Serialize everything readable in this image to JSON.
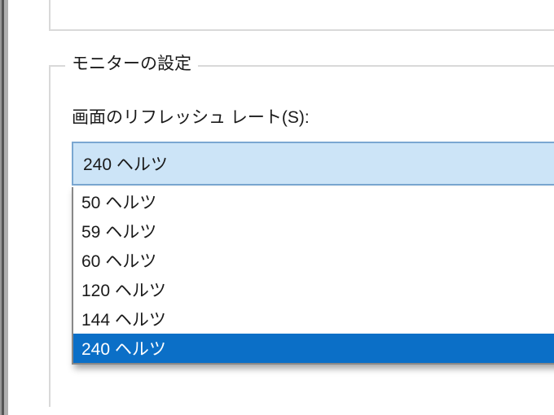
{
  "group": {
    "title": "モニターの設定"
  },
  "refresh_rate": {
    "label": "画面のリフレッシュ レート(S):",
    "selected_display": "240 ヘルツ",
    "options": [
      {
        "label": "50 ヘルツ",
        "selected": false
      },
      {
        "label": "59 ヘルツ",
        "selected": false
      },
      {
        "label": "60 ヘルツ",
        "selected": false
      },
      {
        "label": "120 ヘルツ",
        "selected": false
      },
      {
        "label": "144 ヘルツ",
        "selected": false
      },
      {
        "label": "240 ヘルツ",
        "selected": true
      }
    ]
  },
  "colors": {
    "combo_bg": "#cce4f7",
    "combo_border": "#7aa7d1",
    "selection_bg": "#0b6fc7"
  }
}
